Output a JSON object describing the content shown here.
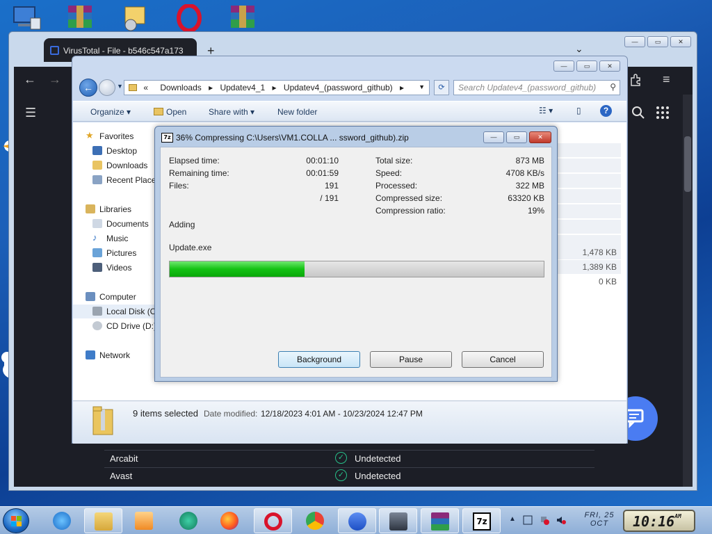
{
  "browser": {
    "tab_title": "VirusTotal - File - b546c547a173",
    "new_tab": "+",
    "tabs_menu": "⌄",
    "rows": [
      {
        "engine": "Arcabit",
        "result": "Undetected"
      },
      {
        "engine": "Avast",
        "result": "Undetected"
      }
    ]
  },
  "explorer": {
    "breadcrumb_prefix": "«",
    "breadcrumb": [
      "Downloads",
      "Updatev4_1",
      "Updatev4_(password_github)"
    ],
    "search_placeholder": "Search Updatev4_(password_github)",
    "toolbar": {
      "organize": "Organize",
      "open": "Open",
      "share_with": "Share with",
      "new_folder": "New folder"
    },
    "nav": {
      "favorites": "Favorites",
      "desktop": "Desktop",
      "downloads": "Downloads",
      "recent": "Recent Places",
      "libraries": "Libraries",
      "documents": "Documents",
      "music": "Music",
      "pictures": "Pictures",
      "videos": "Videos",
      "computer": "Computer",
      "local_disk": "Local Disk (C:)",
      "cd_drive": "CD Drive (D:)",
      "network": "Network"
    },
    "sizes": [
      "1,478 KB",
      "1,389 KB",
      "0 KB"
    ],
    "status": {
      "selected": "9 items selected",
      "date_label": "Date modified:",
      "date_value": "12/18/2023 4:01 AM - 10/23/2024 12:47 PM"
    }
  },
  "dialog": {
    "icon_text": "7z",
    "title": "36% Compressing C:\\Users\\VM1.COLLA ... ssword_github).zip",
    "progress_percent": 36,
    "left_stats": [
      {
        "label": "Elapsed time:",
        "value": "00:01:10"
      },
      {
        "label": "Remaining time:",
        "value": "00:01:59"
      },
      {
        "label": "Files:",
        "value": "191"
      },
      {
        "label": "",
        "value": "/ 191"
      }
    ],
    "right_stats": [
      {
        "label": "Total size:",
        "value": "873 MB"
      },
      {
        "label": "Speed:",
        "value": "4708 KB/s"
      },
      {
        "label": "Processed:",
        "value": "322 MB"
      },
      {
        "label": "Compressed size:",
        "value": "63320 KB"
      },
      {
        "label": "Compression ratio:",
        "value": "19%"
      }
    ],
    "action": "Adding",
    "current_file": "Update.exe",
    "buttons": {
      "background": "Background",
      "pause": "Pause",
      "cancel": "Cancel"
    }
  },
  "taskbar": {
    "date_line1": "FRI, 25",
    "date_line2": "OCT",
    "time": "10:16",
    "ampm": "AM",
    "tray_7z": "7z"
  },
  "colors": {
    "progress_green": "#14c214",
    "vt_background": "#1c1e26",
    "vt_check": "#28c08a",
    "chat_button": "#4a7cf2"
  }
}
